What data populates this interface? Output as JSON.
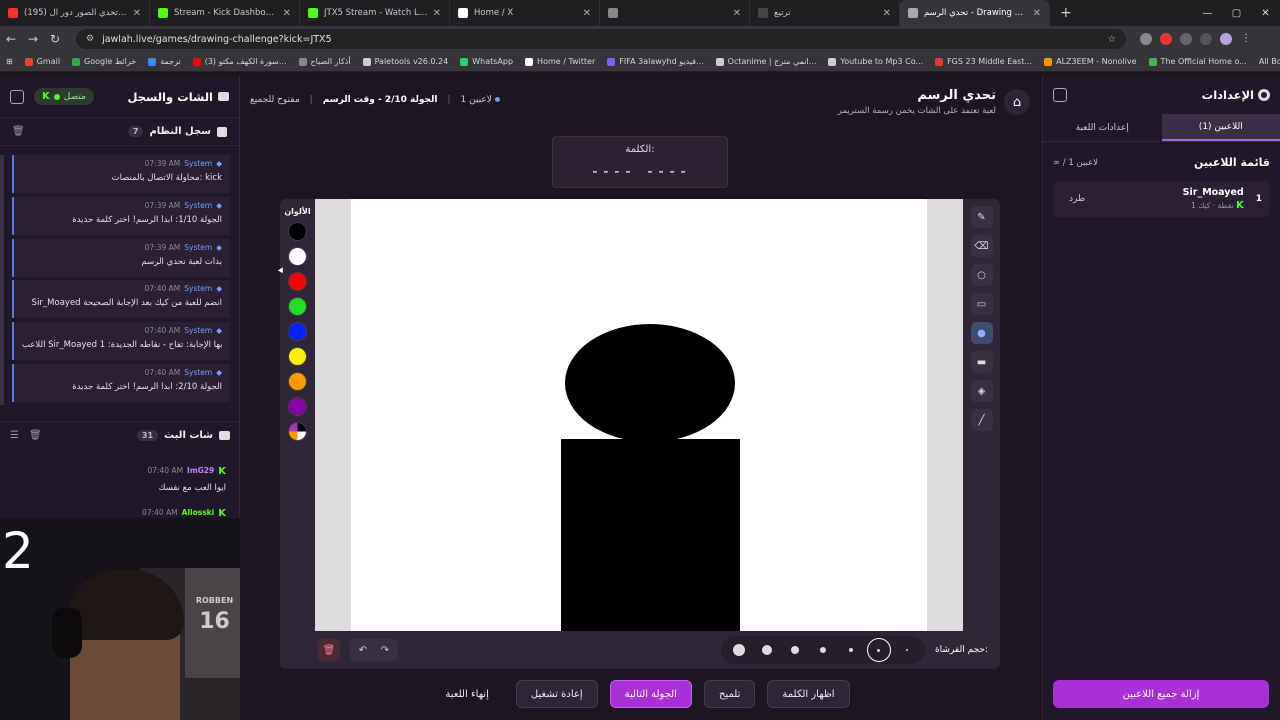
{
  "browser": {
    "tabs": [
      {
        "title": "(195) بطولة تحدي الصور دور ال",
        "color": "#ff3030"
      },
      {
        "title": "Stream - Kick Dashboard",
        "color": "#53fc18"
      },
      {
        "title": "JTX5 Stream - Watch Live on Ki",
        "color": "#53fc18"
      },
      {
        "title": "Home / X",
        "color": "#ffffff"
      },
      {
        "title": "",
        "color": "#888888"
      },
      {
        "title": "ترتيع",
        "color": "#444444"
      },
      {
        "title": "تحدي الرسم - Drawing Challenge",
        "color": "#aaaaaa"
      }
    ],
    "new_tab": "+",
    "window_controls": [
      "—",
      "▢",
      "✕"
    ],
    "url": "jawlah.live/games/drawing-challenge?kick=JTX5",
    "bookmarks": [
      {
        "label": "Gmail",
        "color": "#ea4335"
      },
      {
        "label": "Google خرائط",
        "color": "#34a853"
      },
      {
        "label": "ترجمة",
        "color": "#4285f4"
      },
      {
        "label": "(3) سورة الكهف مكتو...",
        "color": "#ff0000"
      },
      {
        "label": "أذكار الصباح",
        "color": "#888888"
      },
      {
        "label": "Paletools v26.0.24",
        "color": "#cccccc"
      },
      {
        "label": "WhatsApp",
        "color": "#25d366"
      },
      {
        "label": "Home / Twitter",
        "color": "#ffffff"
      },
      {
        "label": "FIFA 3alawyhd فيديو...",
        "color": "#7b61ff"
      },
      {
        "label": "Octanime | انمي مترج...",
        "color": "#cccccc"
      },
      {
        "label": "Youtube to Mp3 Co...",
        "color": "#cccccc"
      },
      {
        "label": "FGS 23 Middle East...",
        "color": "#e53935"
      },
      {
        "label": "ALZ3EEM - Nonolive",
        "color": "#ff9800"
      },
      {
        "label": "The Official Home o...",
        "color": "#4caf50"
      }
    ],
    "all_bookmarks": "All Bookmarks"
  },
  "left": {
    "connection": "متصل",
    "title": "الشات والسجل",
    "system_log": {
      "title": "سجل النظام",
      "count": "7",
      "messages": [
        {
          "time": "07:39 AM",
          "sender": "System",
          "text": "محاولة الاتصال بالمنصات: kick"
        },
        {
          "time": "07:39 AM",
          "sender": "System",
          "text": "الجولة 1/10: ابدأ الرسم! اختر كلمة جديدة"
        },
        {
          "time": "07:39 AM",
          "sender": "System",
          "text": "بدأت لعبة تحدي الرسم"
        },
        {
          "time": "07:40 AM",
          "sender": "System",
          "text": "Sir_Moayed انضم للعبة من كيك بعد الإجابة الصحيحة"
        },
        {
          "time": "07:40 AM",
          "sender": "System",
          "text": "اللاعب Sir_Moayed جاوبها الإجابة: تفاح - نقاطه الجديدة: 1"
        },
        {
          "time": "07:40 AM",
          "sender": "System",
          "text": "الجولة 2/10: ابدأ الرسم! اختر كلمة جديدة"
        }
      ]
    },
    "stream_chat": {
      "title": "شات البث",
      "count": "31",
      "messages": [
        {
          "time": "07:40 AM",
          "user": "ImG29",
          "text": "ايوا العب مع نفسك"
        },
        {
          "time": "07:40 AM",
          "user": "Allosski",
          "text": ""
        }
      ]
    },
    "webcam": {
      "overlay_number": "2",
      "jersey_name": "ROBBEN",
      "jersey_number": "16"
    }
  },
  "main": {
    "game_title": "تحدي الرسم",
    "game_subtitle": "لعبة تعتمد على الشات يخمن رسمة الستريمر",
    "status": {
      "players": "1 لاعبين",
      "round": "الجولة 2/10 - وقت الرسم",
      "mode": "مفتوح للجميع"
    },
    "word_label": "الكلمة:",
    "word_blanks": "---- ----",
    "palette_label": "الألوان",
    "colors": [
      "#000000",
      "#ffffff",
      "#ff0000",
      "#22dd22",
      "#0022ff",
      "#ffee00",
      "#ff9900",
      "#8800aa"
    ],
    "tools": [
      "pencil-icon",
      "eraser-icon",
      "circle-icon",
      "rectangle-icon",
      "filled-circle-icon",
      "filled-rectangle-icon",
      "fill-bucket-icon",
      "line-icon"
    ],
    "selected_tool": 4,
    "brush_size_label": "حجم الفرشاة:",
    "brush_sizes": [
      12,
      10,
      8,
      6,
      4,
      3,
      2
    ],
    "selected_brush": 5,
    "drawing": {
      "shapes": [
        "oval",
        "rectangle"
      ],
      "fill": "#000000"
    },
    "actions": {
      "end": "إنهاء اللعبة",
      "restart": "إعادة تشغيل",
      "next_round": "الجولة التالية",
      "hint": "تلميح",
      "reveal": "اظهار الكلمة"
    }
  },
  "right": {
    "title": "الإعدادات",
    "tabs": {
      "players": "اللاعبين (1)",
      "settings": "إعدادات اللعبة"
    },
    "player_list_title": "قائمة اللاعبين",
    "player_count": "∞ / 1 لاعبين",
    "players": [
      {
        "rank": "1",
        "name": "Sir_Moayed",
        "platform": "كيك",
        "points": "1 نقطة",
        "kick_label": "طرد"
      }
    ],
    "remove_all": "إزالة جميع اللاعبين"
  }
}
